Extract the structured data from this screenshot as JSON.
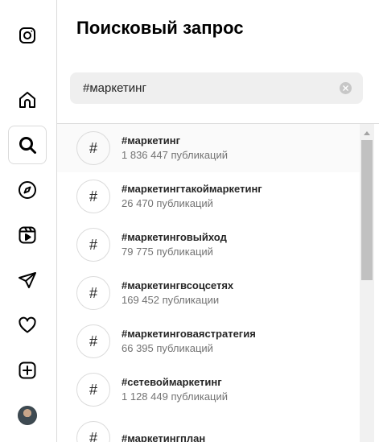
{
  "rail": {
    "items": [
      {
        "name": "instagram-logo-icon",
        "active": false
      },
      {
        "name": "home-icon",
        "active": false
      },
      {
        "name": "search-icon",
        "active": true
      },
      {
        "name": "explore-icon",
        "active": false
      },
      {
        "name": "reels-icon",
        "active": false
      },
      {
        "name": "direct-messages-icon",
        "active": false
      },
      {
        "name": "notifications-heart-icon",
        "active": false
      },
      {
        "name": "create-post-icon",
        "active": false
      },
      {
        "name": "profile-avatar",
        "active": false
      }
    ]
  },
  "search_panel": {
    "title": "Поисковый запрос",
    "query": "#маркетинг",
    "clear_icon": "clear-icon",
    "results": [
      {
        "tag": "#маркетинг",
        "count": "1 836 447 публикаций"
      },
      {
        "tag": "#маркетингтакоймаркетинг",
        "count": "26 470 публикаций"
      },
      {
        "tag": "#маркетинговыйход",
        "count": "79 775 публикаций"
      },
      {
        "tag": "#маркетингвсоцсетях",
        "count": "169 452 публикации"
      },
      {
        "tag": "#маркетинговаястратегия",
        "count": "66 395 публикаций"
      },
      {
        "tag": "#сетевоймаркетинг",
        "count": "1 128 449 публикаций"
      },
      {
        "tag": "#маркетингплан",
        "count": ""
      }
    ],
    "hash_symbol": "#"
  }
}
